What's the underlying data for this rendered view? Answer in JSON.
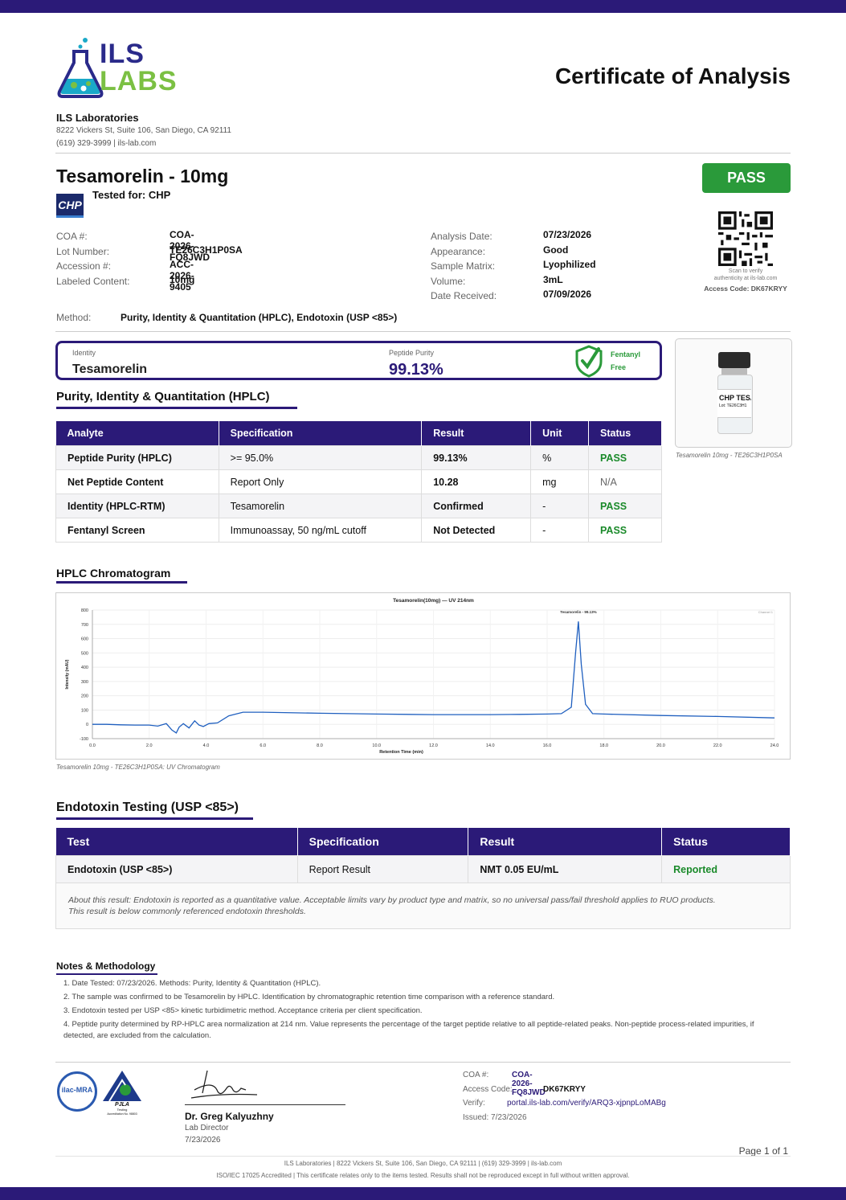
{
  "brand": {
    "line1": "ILS",
    "line2": "LABS"
  },
  "doc_title": "Certificate of Analysis",
  "lab": {
    "name": "ILS Laboratories",
    "address": "8222 Vickers St, Suite 106, San Diego, CA 92111",
    "contact": "(619) 329-3999  |  ils-lab.com"
  },
  "product": {
    "title": "Tesamorelin - 10mg",
    "tested_for": "Tested for: CHP",
    "client_logo": "CHP"
  },
  "status_badge": "PASS",
  "qr": {
    "caption1": "Scan to verify",
    "caption2": "authenticity at ils-lab.com",
    "access": "Access Code: DK67KRYY"
  },
  "fields_left": [
    {
      "label": "COA #:",
      "value": "COA-2026-FQ8JWD"
    },
    {
      "label": "Lot Number:",
      "value": "TE26C3H1P0SA"
    },
    {
      "label": "Accession #:",
      "value": "ACC-2026-9405"
    },
    {
      "label": "Labeled Content:",
      "value": "10mg"
    }
  ],
  "fields_right": [
    {
      "label": "Analysis Date:",
      "value": "07/23/2026"
    },
    {
      "label": "Appearance:",
      "value": "Good"
    },
    {
      "label": "Sample Matrix:",
      "value": "Lyophilized"
    },
    {
      "label": "Volume:",
      "value": "3mL"
    },
    {
      "label": "Date Received:",
      "value": "07/09/2026"
    }
  ],
  "method": {
    "label": "Method:",
    "value": "Purity, Identity & Quantitation (HPLC), Endotoxin (USP <85>)"
  },
  "summary": {
    "identity_label": "Identity",
    "identity_value": "Tesamorelin",
    "purity_label": "Peptide Purity",
    "purity_value": "99.13%",
    "fentanyl1": "Fentanyl",
    "fentanyl2": "Free"
  },
  "vial": {
    "label1": "CHP TESA",
    "label2": "Lot: TE26C3H1",
    "caption": "Tesamorelin 10mg - TE26C3H1P0SA"
  },
  "hplc": {
    "title": "Purity, Identity & Quantitation (HPLC)",
    "headers": [
      "Analyte",
      "Specification",
      "Result",
      "Unit",
      "Status"
    ],
    "rows": [
      [
        "Peptide Purity (HPLC)",
        ">= 95.0%",
        "99.13%",
        "%",
        "PASS"
      ],
      [
        "Net Peptide Content",
        "Report Only",
        "10.28",
        "mg",
        "N/A"
      ],
      [
        "Identity (HPLC-RTM)",
        "Tesamorelin",
        "Confirmed",
        "-",
        "PASS"
      ],
      [
        "Fentanyl Screen",
        "Immunoassay, 50 ng/mL cutoff",
        "Not Detected",
        "-",
        "PASS"
      ]
    ]
  },
  "chromatogram_section": {
    "title": "HPLC Chromatogram",
    "caption": "Tesamorelin 10mg - TE26C3H1P0SA: UV Chromatogram"
  },
  "chart_data": {
    "type": "line",
    "title": "Tesamorelin(10mg) — UV 214nm",
    "xlabel": "Retention Time (min)",
    "ylabel": "Intensity (mAU)",
    "xlim": [
      0,
      24
    ],
    "ylim": [
      -100,
      800
    ],
    "xticks": [
      "0.0",
      "2.0",
      "4.0",
      "6.0",
      "8.0",
      "10.0",
      "12.0",
      "14.0",
      "16.0",
      "18.0",
      "20.0",
      "22.0",
      "24.0"
    ],
    "yticks": [
      "-100",
      "0",
      "100",
      "200",
      "300",
      "400",
      "500",
      "600",
      "700",
      "800"
    ],
    "peak_label": "Tesamorelin - 99.13%",
    "legend": "Channel 1",
    "x": [
      0,
      0.5,
      1.0,
      1.5,
      2.0,
      2.3,
      2.6,
      2.8,
      2.95,
      3.05,
      3.2,
      3.4,
      3.6,
      3.75,
      3.9,
      4.1,
      4.4,
      4.8,
      5.3,
      6,
      8,
      10,
      12,
      14,
      15,
      16,
      16.5,
      16.85,
      17.0,
      17.1,
      17.2,
      17.35,
      17.6,
      18,
      20,
      22,
      24
    ],
    "y": [
      0,
      0,
      -3,
      -5,
      -5,
      -12,
      5,
      -40,
      -60,
      -20,
      5,
      -25,
      25,
      -5,
      -15,
      5,
      10,
      60,
      85,
      85,
      78,
      72,
      68,
      68,
      70,
      72,
      75,
      120,
      500,
      720,
      420,
      140,
      75,
      72,
      62,
      55,
      45
    ]
  },
  "endotoxin": {
    "title": "Endotoxin Testing (USP <85>)",
    "headers": [
      "Test",
      "Specification",
      "Result",
      "Status"
    ],
    "row": [
      "Endotoxin (USP <85>)",
      "Report Result",
      "NMT 0.05 EU/mL",
      "Reported"
    ],
    "note1": "About this result: Endotoxin is reported as a quantitative value. Acceptable limits vary by product type and matrix, so no universal pass/fail threshold applies to RUO products.",
    "note2": "This result is below commonly referenced endotoxin thresholds."
  },
  "notes": {
    "title": "Notes & Methodology",
    "items": [
      "1. Date Tested: 07/23/2026. Methods: Purity, Identity & Quantitation (HPLC).",
      "2. The sample was confirmed to be Tesamorelin by HPLC. Identification by chromatographic retention time comparison with a reference standard.",
      "3. Endotoxin tested per USP <85> kinetic turbidimetric method. Acceptance criteria per client specification.",
      "4. Peptide purity determined by RP-HPLC area normalization at 214 nm. Value represents the percentage of the target peptide relative to all peptide-related peaks. Non-peptide process-related impurities, if",
      "detected, are excluded from the calculation."
    ]
  },
  "accreditation": {
    "ilac": "ilac-MRA",
    "pjla": "PJLA",
    "pjla_sub": "Testing",
    "pjla_no": "Accreditation No. 98803"
  },
  "signer": {
    "name": "Dr. Greg Kalyuzhny",
    "role": "Lab Director",
    "date": "7/23/2026"
  },
  "verify": {
    "coa_label": "COA #:",
    "coa_value": "COA-2026-FQ8JWD",
    "access_label": "Access Code:",
    "access_value": "DK67KRYY",
    "verify_label": "Verify:",
    "verify_value": "portal.ils-lab.com/verify/ARQ3-xjpnpLoMABg",
    "issued": "Issued: 7/23/2026"
  },
  "page": "Page 1 of 1",
  "footer": {
    "line1": "ILS Laboratories  |  8222 Vickers St, Suite 106, San Diego, CA 92111  |  (619) 329-3999  |  ils-lab.com",
    "line2": "ISO/IEC 17025 Accredited  |  This certificate relates only to the items tested. Results shall not be reproduced except in full without written approval."
  }
}
